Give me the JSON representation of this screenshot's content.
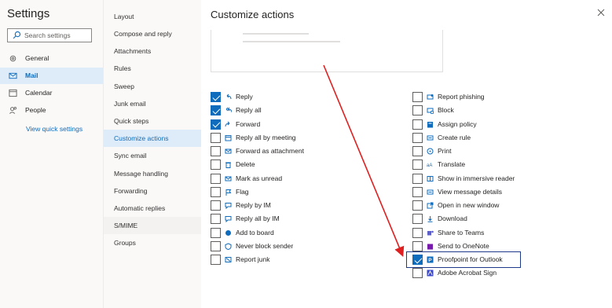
{
  "settings": {
    "title": "Settings"
  },
  "search": {
    "placeholder": "Search settings"
  },
  "leftnav": [
    {
      "label": "General",
      "icon": "gear-icon",
      "selected": false
    },
    {
      "label": "Mail",
      "icon": "mail-icon",
      "selected": true
    },
    {
      "label": "Calendar",
      "icon": "calendar-icon",
      "selected": false
    },
    {
      "label": "People",
      "icon": "people-icon",
      "selected": false
    }
  ],
  "quick_settings": "View quick settings",
  "subnav": [
    {
      "label": "Layout"
    },
    {
      "label": "Compose and reply"
    },
    {
      "label": "Attachments"
    },
    {
      "label": "Rules"
    },
    {
      "label": "Sweep"
    },
    {
      "label": "Junk email"
    },
    {
      "label": "Quick steps"
    },
    {
      "label": "Customize actions",
      "selected": true
    },
    {
      "label": "Sync email"
    },
    {
      "label": "Message handling"
    },
    {
      "label": "Forwarding"
    },
    {
      "label": "Automatic replies"
    },
    {
      "label": "S/MIME",
      "shaded": true
    },
    {
      "label": "Groups"
    }
  ],
  "main": {
    "title": "Customize actions"
  },
  "actions_left": [
    {
      "label": "Reply",
      "checked": true,
      "icon": "reply-icon"
    },
    {
      "label": "Reply all",
      "checked": true,
      "icon": "reply-all-icon"
    },
    {
      "label": "Forward",
      "checked": true,
      "icon": "forward-icon"
    },
    {
      "label": "Reply all by meeting",
      "checked": false,
      "icon": "meeting-icon"
    },
    {
      "label": "Forward as attachment",
      "checked": false,
      "icon": "attachment-icon"
    },
    {
      "label": "Delete",
      "checked": false,
      "icon": "trash-icon"
    },
    {
      "label": "Mark as unread",
      "checked": false,
      "icon": "envelope-icon"
    },
    {
      "label": "Flag",
      "checked": false,
      "icon": "flag-icon"
    },
    {
      "label": "Reply by IM",
      "checked": false,
      "icon": "im-icon"
    },
    {
      "label": "Reply all by IM",
      "checked": false,
      "icon": "im-all-icon"
    },
    {
      "label": "Add to board",
      "checked": false,
      "icon": "board-icon"
    },
    {
      "label": "Never block sender",
      "checked": false,
      "icon": "shield-icon"
    },
    {
      "label": "Report junk",
      "checked": false,
      "icon": "junk-icon"
    }
  ],
  "actions_right": [
    {
      "label": "Report phishing",
      "checked": false,
      "icon": "phishing-icon"
    },
    {
      "label": "Block",
      "checked": false,
      "icon": "block-icon"
    },
    {
      "label": "Assign policy",
      "checked": false,
      "icon": "policy-icon"
    },
    {
      "label": "Create rule",
      "checked": false,
      "icon": "rule-icon"
    },
    {
      "label": "Print",
      "checked": false,
      "icon": "print-icon"
    },
    {
      "label": "Translate",
      "checked": false,
      "icon": "translate-icon"
    },
    {
      "label": "Show in immersive reader",
      "checked": false,
      "icon": "reader-icon"
    },
    {
      "label": "View message details",
      "checked": false,
      "icon": "details-icon"
    },
    {
      "label": "Open in new window",
      "checked": false,
      "icon": "new-window-icon"
    },
    {
      "label": "Download",
      "checked": false,
      "icon": "download-icon"
    },
    {
      "label": "Share to Teams",
      "checked": false,
      "icon": "teams-icon"
    },
    {
      "label": "Send to OneNote",
      "checked": false,
      "icon": "onenote-icon"
    },
    {
      "label": "Proofpoint for Outlook",
      "checked": true,
      "icon": "proofpoint-icon"
    },
    {
      "label": "Adobe Acrobat Sign",
      "checked": false,
      "icon": "acrobat-icon"
    }
  ],
  "colors": {
    "accent": "#0f6cbd",
    "annotation_arrow": "#e02020",
    "highlight_box": "#1f3a8a"
  }
}
